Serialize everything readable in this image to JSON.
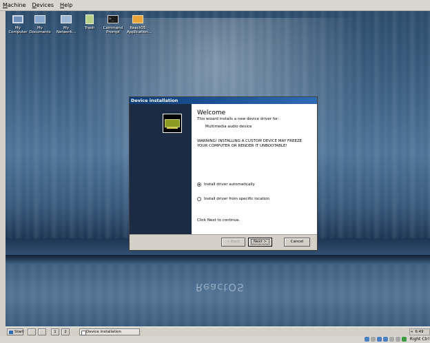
{
  "host_menu": {
    "items": [
      {
        "label": "Machine",
        "mnemonic": "M",
        "rest": "achine"
      },
      {
        "label": "Devices",
        "mnemonic": "D",
        "rest": "evices"
      },
      {
        "label": "Help",
        "mnemonic": "H",
        "rest": "elp"
      }
    ]
  },
  "desktop_icons": [
    {
      "line1": "My",
      "line2": "Computer",
      "icon": "computer-icon"
    },
    {
      "line1": "My",
      "line2": "Documents",
      "icon": "folder-icon"
    },
    {
      "line1": "My",
      "line2": "Network...",
      "icon": "network-icon"
    },
    {
      "line1": "Trash",
      "line2": "",
      "icon": "trash-icon"
    },
    {
      "line1": "Command",
      "line2": "Prompt",
      "icon": "command-prompt-icon"
    },
    {
      "line1": "ReactOS",
      "line2": "Application...",
      "icon": "app-manager-icon"
    }
  ],
  "desktop": {
    "wordmark": "ReactOS"
  },
  "dialog": {
    "title": "Device installation",
    "heading": "Welcome",
    "intro": "This wizard installs a new device driver for:",
    "device_name": "Multimedia audio device",
    "warning_line1": "WARNING! INSTALLING A CUSTOM DEVICE MAY FREEZE",
    "warning_line2": "YOUR COMPUTER OR RENDER IT UNBOOTABLE!",
    "option_auto": "Install driver automatically",
    "option_specific": "Install driver from specific location",
    "selected_option": "auto",
    "hint": "Click Next to continue.",
    "back_label": "< Back",
    "next_label": "Next >",
    "cancel_label": "Cancel"
  },
  "taskbar": {
    "start_label": "Start",
    "quicklaunch": [
      "1",
      "2"
    ],
    "task_label": "Device installation",
    "tray_text": "6:49"
  },
  "host_status": {
    "host_key": "Right Ctrl"
  }
}
